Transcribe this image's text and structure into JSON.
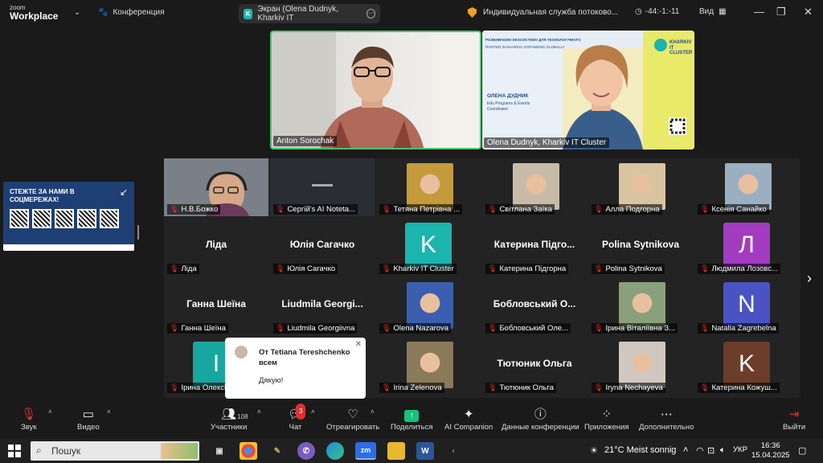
{
  "app": {
    "logo_top": "zoom",
    "logo_bottom": "Workplace",
    "conference": "Конференция"
  },
  "share_pill": {
    "label": "Экран (Olena Dudnyk, Kharkiv IT"
  },
  "stream": {
    "label": "Индивидуальная служба потоково..."
  },
  "timer": {
    "value": "-44:-1:-11"
  },
  "view": {
    "label": "Вид"
  },
  "speakers": [
    {
      "name": "Anton Sorochak"
    },
    {
      "name": "Olena Dudnyk, Kharkiv IT Cluster"
    }
  ],
  "slide": {
    "heading": "РОЗВИВАЄМО ЕКОСИСТЕМУ ДЛЯ ТЕХНОЛОГІЧНОГО",
    "sub": "ROOTED IN KHARKIV, EXPANDING GLOBALLY",
    "brand1": "KHARKIV",
    "brand2": "IT CLUSTER",
    "person": "ОЛЕНА ДУДНИК",
    "role1": "Edu Programs & Events",
    "role2": "Coordinator"
  },
  "participants": [
    {
      "name": "Н.В.Божко",
      "kind": "video",
      "color": "#6a6f78"
    },
    {
      "name": "Сергій's AI Notetа...",
      "kind": "video",
      "color": "#2a2d33"
    },
    {
      "name": "Тетяна Петрівна ...",
      "kind": "photo",
      "color": "#c49a3a"
    },
    {
      "name": "Світлана Заїка",
      "kind": "photo",
      "color": "#c7bba8"
    },
    {
      "name": "Алла Подгорна",
      "kind": "photo",
      "color": "#d8c4a0"
    },
    {
      "name": "Ксенія Санайко",
      "kind": "photo",
      "color": "#9ab0c0"
    },
    {
      "name": "Ліда",
      "big": "Ліда",
      "kind": "text"
    },
    {
      "name": "Юлія Сагачко",
      "big": "Юлія Сагачко",
      "kind": "text"
    },
    {
      "name": "Kharkiv IT Cluster",
      "kind": "logo",
      "color": "#1bb5ad",
      "letter": "K"
    },
    {
      "name": "Катерина Підгорна",
      "big": "Катерина Підго...",
      "kind": "text"
    },
    {
      "name": "Polina Sytnikova",
      "big": "Polina Sytnikova",
      "kind": "text"
    },
    {
      "name": "Людмила Лозовс...",
      "kind": "letter",
      "color": "#a23bbf",
      "letter": "Л"
    },
    {
      "name": "Ганна Шеїна",
      "big": "Ганна Шеїна",
      "kind": "text"
    },
    {
      "name": "Liudmila Georgiivna",
      "big": "Liudmila Georgi...",
      "kind": "text"
    },
    {
      "name": "Olena Nazarova",
      "kind": "photo",
      "color": "#3b5fb0"
    },
    {
      "name": "Бобловський Оле...",
      "big": "Бобловський О...",
      "kind": "text"
    },
    {
      "name": "Ірина Віталіївна З...",
      "kind": "photo",
      "color": "#8aa07a"
    },
    {
      "name": "Natalia Zagrebelna",
      "kind": "letter",
      "color": "#4a53c4",
      "letter": "N"
    },
    {
      "name": "Ірина Олексі...",
      "kind": "letter",
      "color": "#18a6a0",
      "letter": "I"
    },
    {
      "name": "",
      "kind": "empty"
    },
    {
      "name": "Irina Zelenova",
      "kind": "photo",
      "color": "#8a7a5a"
    },
    {
      "name": "Тютюник Ольга",
      "big": "Тютюник Ольга",
      "kind": "text"
    },
    {
      "name": "Iryna Nechayeva",
      "kind": "photo",
      "color": "#d0c8c0"
    },
    {
      "name": "Катерина Кожуш...",
      "kind": "letter",
      "color": "#6b3d2a",
      "letter": "K"
    }
  ],
  "qr_ad": {
    "title_line1": "СТЕЖТЕ ЗА НАМИ В",
    "title_line2": "СОЦМЕРЕЖАХ!"
  },
  "toast": {
    "from_line1": "От Tetiana Tereshchenko",
    "from_line2": "всем",
    "message": "Дякую!"
  },
  "toolbar": {
    "audio": "Звук",
    "video": "Видео",
    "participants": "Участники",
    "participants_count": "108",
    "chat": "Чат",
    "chat_badge": "3",
    "react": "Отреагировать",
    "share": "Поделиться",
    "ai": "AI Companion",
    "info": "Данные конференции",
    "apps": "Приложения",
    "more": "Дополнительно",
    "leave": "Выйти"
  },
  "taskbar": {
    "search_placeholder": "Пошук",
    "weather": "21°C  Meist sonnig",
    "lang": "УКР",
    "time": "16:36",
    "date": "15.04.2025"
  },
  "colors": {
    "accent_green": "#4ac06c",
    "share_green": "#16c27a",
    "muted_red": "#e0302f"
  }
}
